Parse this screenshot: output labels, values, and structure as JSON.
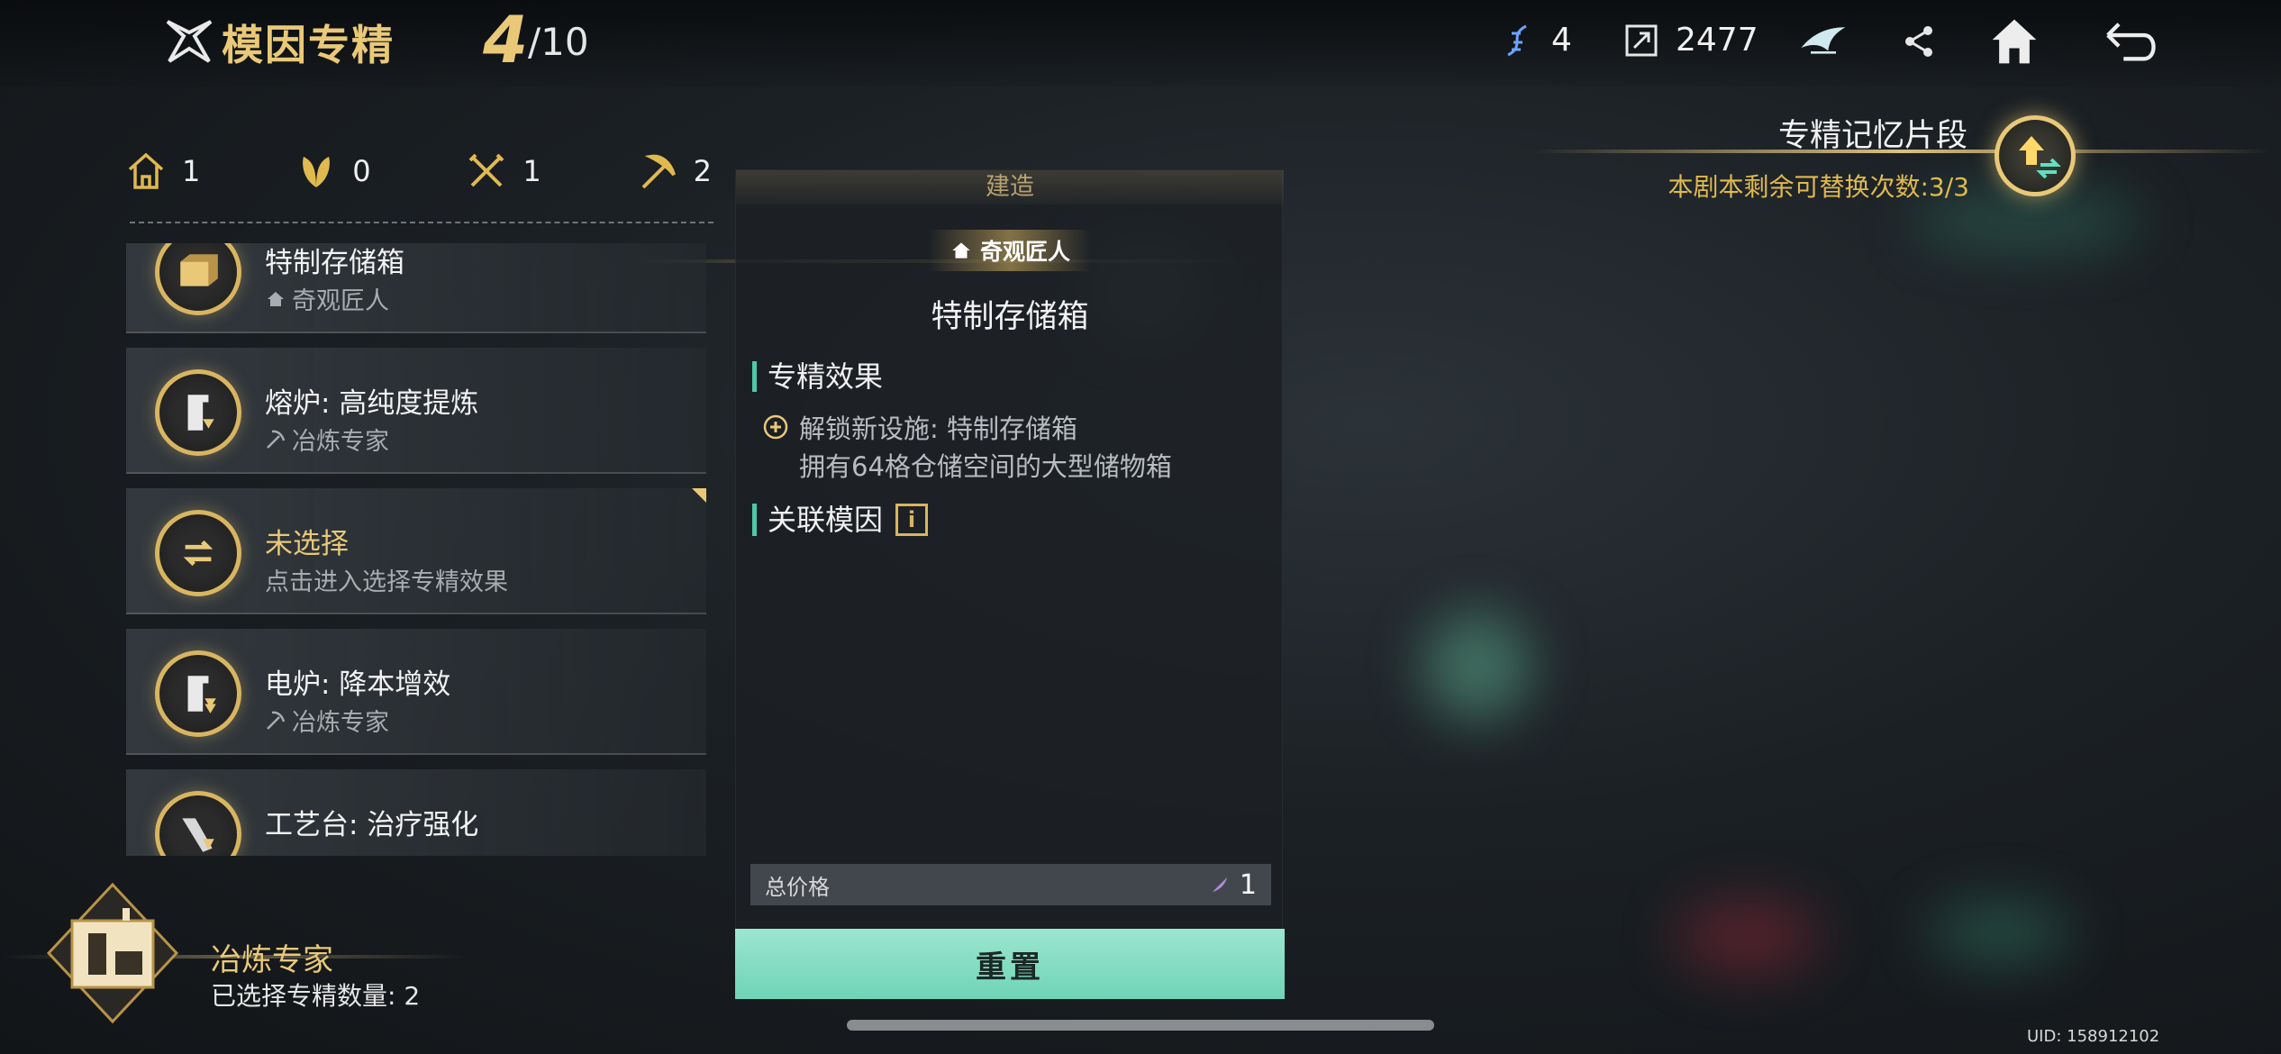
{
  "header": {
    "title": "模因专精",
    "count_current": "4",
    "count_total": "/10",
    "resource1_value": "4",
    "resource2_value": "2477",
    "icons": [
      "dna-icon",
      "expand-icon",
      "bird-emblem-icon",
      "share-icon",
      "home-icon",
      "back-icon"
    ]
  },
  "filters": [
    {
      "icon": "house-icon",
      "value": "1"
    },
    {
      "icon": "leaf-icon",
      "value": "0"
    },
    {
      "icon": "tools-icon",
      "value": "1"
    },
    {
      "icon": "pickaxe-icon",
      "value": "2"
    }
  ],
  "list": [
    {
      "name": "特制存储箱",
      "sub": "奇观匠人",
      "sub_icon": "house-icon"
    },
    {
      "name": "熔炉: 高纯度提炼",
      "sub": "冶炼专家",
      "sub_icon": "pickaxe-icon"
    },
    {
      "name": "未选择",
      "sub": "点击进入选择专精效果",
      "sub_icon": ""
    },
    {
      "name": "电炉: 降本增效",
      "sub": "冶炼专家",
      "sub_icon": "pickaxe-icon"
    },
    {
      "name": "工艺台: 治疗强化",
      "sub": "",
      "sub_icon": ""
    }
  ],
  "profile": {
    "name": "冶炼专家",
    "selected_count": "已选择专精数量: 2"
  },
  "detail": {
    "header": "建造",
    "category": "奇观匠人",
    "title": "特制存储箱",
    "section_effect": "专精效果",
    "effect_line": "解锁新设施: 特制存储箱",
    "effect_desc": "拥有64格仓储空间的大型储物箱",
    "section_related": "关联模因",
    "info_icon_text": "i",
    "price_label": "总价格",
    "price_value": "1",
    "reset_label": "重置"
  },
  "memory": {
    "title": "专精记忆片段",
    "subtitle": "本剧本剩余可替换次数:3/3"
  },
  "uid": "UID: 158912102",
  "colors": {
    "gold": "#e9c978",
    "teal": "#6fd4b5",
    "accent_bar": "#4fc8a8"
  }
}
